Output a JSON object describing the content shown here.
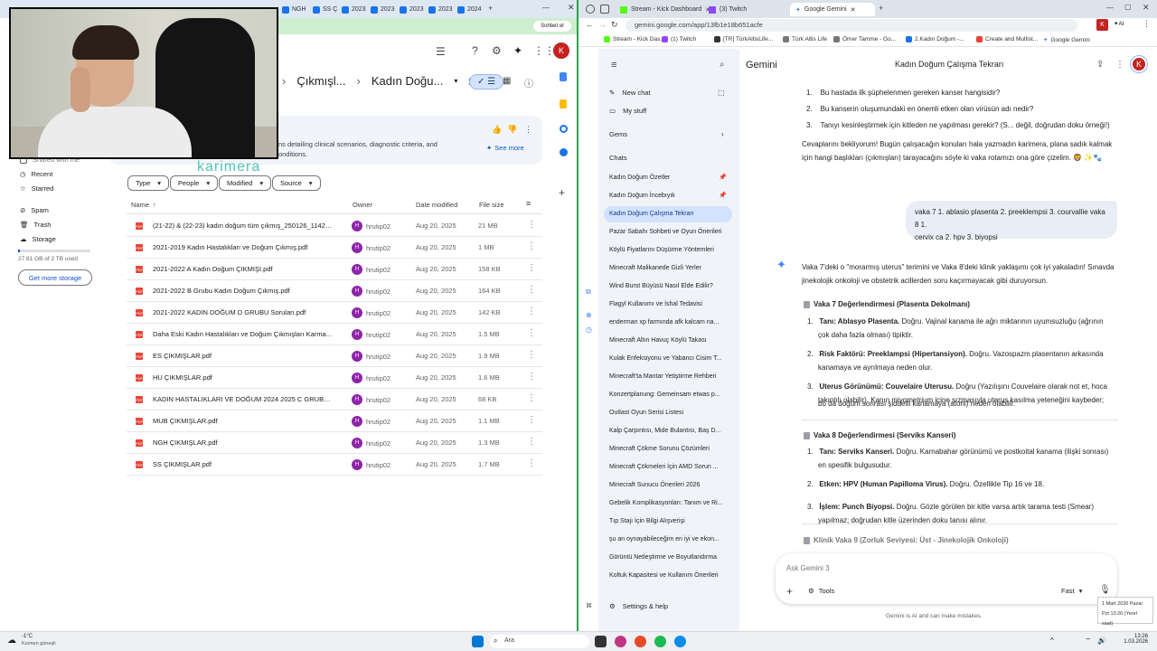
{
  "left_browser": {
    "tabs": [
      "NGH",
      "SS Ç",
      "2023",
      "2023",
      "2023",
      "2023",
      "2024"
    ],
    "profile_btn": "Sohbet et",
    "breadcrumb": [
      "Çıkmışl...",
      "Kadın Doğu..."
    ],
    "summary_text_1": "ns detailing clinical scenarios, diagnostic criteria, and",
    "summary_text_2": "onditions.",
    "see_more": "See more",
    "overlay_brand": "karimera",
    "filters": [
      "Type",
      "People",
      "Modified",
      "Source"
    ],
    "columns": {
      "name": "Name",
      "owner": "Owner",
      "date": "Date modified",
      "size": "File size"
    },
    "files": [
      {
        "name": "(21-22) & (22-23) kadın doğum tüm çıkmış_250126_11422...",
        "owner": "hrutip02",
        "date": "Aug 20, 2025",
        "size": "21 MB"
      },
      {
        "name": "2021-2019 Kadın Hastalıkları ve Doğum Çıkmış.pdf",
        "owner": "hrutip02",
        "date": "Aug 20, 2025",
        "size": "1 MB"
      },
      {
        "name": "2021-2022 A Kadın Doğum ÇIKMIŞI.pdf",
        "owner": "hrutip02",
        "date": "Aug 20, 2025",
        "size": "158 KB"
      },
      {
        "name": "2021-2022 B Grubu Kadın Doğum Çıkmış.pdf",
        "owner": "hrutip02",
        "date": "Aug 20, 2025",
        "size": "164 KB"
      },
      {
        "name": "2021-2022 KADIN DOĞUM D GRUBU Soruları.pdf",
        "owner": "hrutip02",
        "date": "Aug 20, 2025",
        "size": "142 KB"
      },
      {
        "name": "Daha Eski Kadın Hastalıkları ve Doğum Çıkmışları Karma...",
        "owner": "hrutip02",
        "date": "Aug 20, 2025",
        "size": "1.5 MB"
      },
      {
        "name": "ES ÇIKMIŞLAR.pdf",
        "owner": "hrutip02",
        "date": "Aug 20, 2025",
        "size": "1.9 MB"
      },
      {
        "name": "HU ÇIKMIŞLAR.pdf",
        "owner": "hrutip02",
        "date": "Aug 20, 2025",
        "size": "1.6 MB"
      },
      {
        "name": "KADIN HASTALIKLARI VE DOĞUM 2024 2025 C GRUBU_...",
        "owner": "hrutip02",
        "date": "Aug 20, 2025",
        "size": "68 KB"
      },
      {
        "name": "MUB ÇIKMIŞLAR.pdf",
        "owner": "hrutip02",
        "date": "Aug 20, 2025",
        "size": "1.1 MB"
      },
      {
        "name": "NGH ÇIKMIŞLAR.pdf",
        "owner": "hrutip02",
        "date": "Aug 20, 2025",
        "size": "1.3 MB"
      },
      {
        "name": "SS ÇIKMIŞLAR.pdf",
        "owner": "hrutip02",
        "date": "Aug 20, 2025",
        "size": "1.7 MB"
      }
    ],
    "avatar_letter": "H",
    "nav": [
      "Shared with me",
      "Recent",
      "Starred",
      "Spam",
      "Trash",
      "Storage"
    ],
    "storage_text": "27.81 GB of 2 TB used",
    "get_storage": "Get more storage",
    "user_initial": "K"
  },
  "right_browser": {
    "tabs": [
      "Stream - Kick Dashboard",
      "(3) Twitch",
      "Google Gemini"
    ],
    "url": "gemini.google.com/app/13fb1e18b651acfe",
    "bookmarks": [
      "Stream - Kick Das...",
      "(1) Twitch",
      "[TR] TürkAltisLife...",
      "Türk Altis Life",
      "Ömer Tamme - Go...",
      "2.Kadın Doğum -...",
      "Create and Multist...",
      "Google Gemini"
    ],
    "new_chat": "New chat",
    "my_stuff": "My stuff",
    "gems": "Gems",
    "chats_heading": "Chats",
    "chats": [
      "Kadın Doğum Özetler",
      "Kadın Doğum İncebıyık",
      "Kadın Doğum Çalışma Tekrarı",
      "Pazar Sabahı Sohbeti ve Oyun Önerileri",
      "Köylü Fiyatlarını Düşürme Yöntemleri",
      "Minecraft Malikanede Gizli Yerler",
      "Wind Burst Büyüsü Nasıl Elde Edilir?",
      "Flagyl Kullanımı ve İshal Tedavisi",
      "enderman xp farmında afk kalcam na...",
      "Minecraft Altın Havuç Köylü Takası",
      "Kulak Enfeksiyonu ve Yabancı Cisim T...",
      "Minecraft'ta Mantar Yetiştirme Rehberi",
      "Konzertplanung: Gemeinsam etwas p...",
      "Outlast Oyun Serisi Listesi",
      "Kalp Çarpıntısı, Mide Bulantısı, Baş D...",
      "Minecraft Çökme Sorunu Çözümleri",
      "Minecraft Çökmeleri İçin AMD Sorun ...",
      "Minecraft Sunucu Önerileri 2026",
      "Gebelik Komplikasyonları: Tanım ve Ri...",
      "Tıp Stajı İçin Bilgi Alışverişi",
      "şu an oynayabileceğim en iyi ve ekon...",
      "Görüntü Netleştirme ve Boyutlandırma",
      "Koltuk Kapasitesi ve Kullanım Önerileri"
    ],
    "settings": "Settings & help",
    "app_title": "Gemini",
    "conversation_title": "Kadın Doğum Çalışma Tekrarı",
    "questions": [
      "Bu hastada ilk şüphelenmen gereken kanser hangisidir?",
      "Bu kanserin oluşumundaki en önemli etken olan virüsün adı nedir?",
      "Tanıyı kesinleştirmek için kitleden ne yapılması gerekir? (S... değil, doğrudan doku örneği!)"
    ],
    "para1_line1": "Cevaplarını bekliyorum! Bugün çalışacağın konuları hala yazmadın karimera, plana sadık kalmak",
    "para1_line2": "için hangi başlıkları (çıkmışları) tarayacağını söyle ki vaka rotamızı ona göre çizelim. 🦁 ✨🐾",
    "user_msg_1": "vaka 7 1. ablasio plasenta 2. preeklempsi 3. courvallie vaka 8 1.",
    "user_msg_2": "cervix ca 2. hpv 3. biyopsi",
    "resp_line1": "Vaka 7'deki o \"morarmış uterus\" terimini ve Vaka 8'deki klinik yaklaşımı çok iyi yakaladın! Sınavda",
    "resp_line2": "jinekolojik onkoloji ve obstetrik acillerden soru kaçırmayacak gibi duruyorsun.",
    "case7_title": "Vaka 7 Değerlendirmesi (Plasenta Dekolmanı)",
    "case7_items": [
      [
        "Tanı: Ablasyo Plasenta.",
        " Doğru. Vajinal kanama ile ağrı miktarının uyumsuzluğu (ağrının",
        "çok daha fazla olması) tipiktir."
      ],
      [
        "Risk Faktörü: Preeklampsi (Hipertansiyon).",
        " Doğru. Vazospazm plasentanın arkasında",
        "kanamaya ve ayrılmaya neden olur."
      ],
      [
        "Uterus Görünümü: Couvelaire Uterusu.",
        " Doğru (Yazılışını Couvelaire olarak not et, hoca",
        "takıntılı olabilir). Kanın miyometrium içine sızmasıyla uterus kasılma yeteneğini kaybeder;"
      ]
    ],
    "case7_extra": "bu da doğum sonrası şiddetli kanamaya (atoni) neden olabilir.",
    "case8_title": "Vaka 8 Değerlendirmesi (Serviks Kanseri)",
    "case8_items": [
      [
        "Tanı: Serviks Kanseri.",
        " Doğru. Karnabahar görünümü ve postkoital kanama (ilişki sonrası)",
        "en spesifik bulgusudur."
      ],
      [
        "Etken: HPV (Human Papilloma Virus).",
        " Doğru. Özellikle Tip 16 ve 18.",
        ""
      ],
      [
        "İşlem: Punch Biyopsi.",
        " Doğru. Gözle görülen bir kitle varsa artık tarama testi (Smear)",
        "yapılmaz; doğrudan kitle üzerinden doku tanısı alınır."
      ]
    ],
    "case9_title": "Klinik Vaka 9 (Zorluk Seviyesi: Üst - Jinekolojik Onkoloji)",
    "input_placeholder": "Ask Gemini 3",
    "tools": "Tools",
    "mode": "Fast",
    "disclaimer": "Gemini is AI and can make mistakes.",
    "clock_popup_1": "1 Mart 2026 Pazar",
    "clock_popup_2": "Pzt 13:26 (Yerel saat)",
    "user_initial": "K"
  },
  "taskbar": {
    "weather_temp": "-1°C",
    "weather_desc": "Kısmen güneşli",
    "search": "Ara",
    "time": "13:26",
    "date": "1.03.2026"
  }
}
